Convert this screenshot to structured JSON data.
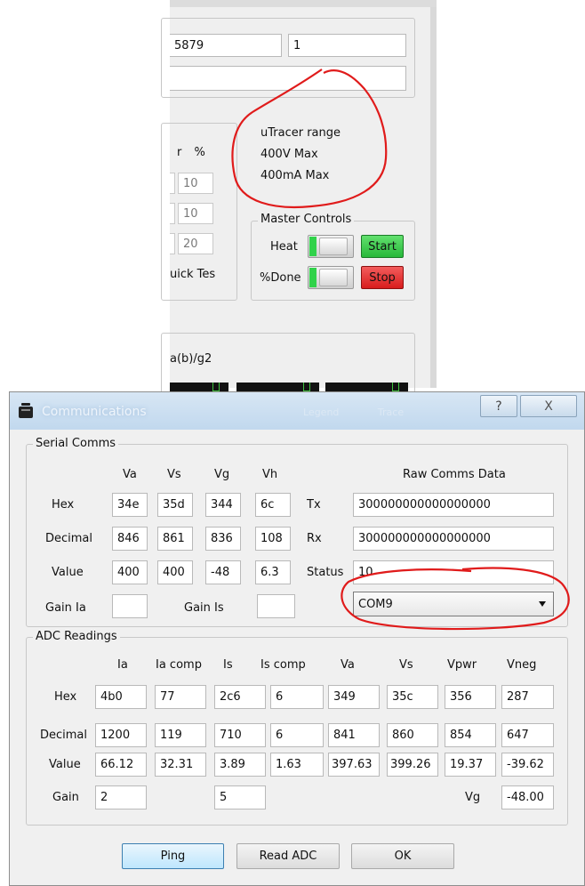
{
  "bg_window": {
    "row1": {
      "field_a": "5879",
      "field_b": "1"
    },
    "note": {
      "line1": "uTracer range",
      "line2": "400V Max",
      "line3": "400mA Max"
    },
    "percent_header": "r   %",
    "percent_fields": [
      "10",
      "10",
      "20"
    ],
    "quick_test_label": "uick Tes",
    "master_controls": {
      "title": "Master Controls",
      "heat_label": "Heat",
      "start_label": "Start",
      "done_label": "%Done",
      "stop_label": "Stop"
    },
    "graph_label": "a(b)/g2"
  },
  "dialog": {
    "title": "Communications",
    "behind_title_text": "Legend   Trace",
    "help_glyph": "?",
    "close_glyph": "X",
    "serial": {
      "title": "Serial Comms",
      "headers": [
        "Va",
        "Vs",
        "Vg",
        "Vh"
      ],
      "raw_header": "Raw Comms Data",
      "rows": [
        {
          "label": "Hex",
          "values": [
            "34e",
            "35d",
            "344",
            "6c"
          ],
          "side_label": "Tx",
          "side_value": "300000000000000000"
        },
        {
          "label": "Decimal",
          "values": [
            "846",
            "861",
            "836",
            "108"
          ],
          "side_label": "Rx",
          "side_value": "300000000000000000"
        },
        {
          "label": "Value",
          "values": [
            "400",
            "400",
            "-48",
            "6.3"
          ],
          "side_label": "Status",
          "side_value": "10"
        }
      ],
      "gain_ia_label": "Gain Ia",
      "gain_ia_value": "",
      "gain_is_label": "Gain Is",
      "gain_is_value": "",
      "port_selected": "COM9"
    },
    "adc": {
      "title": "ADC Readings",
      "headers": [
        "Ia",
        "Ia comp",
        "Is",
        "Is comp",
        "Va",
        "Vs",
        "Vpwr",
        "Vneg"
      ],
      "rows": [
        {
          "label": "Hex",
          "values": [
            "4b0",
            "77",
            "2c6",
            "6",
            "349",
            "35c",
            "356",
            "287"
          ]
        },
        {
          "label": "Decimal",
          "values": [
            "1200",
            "119",
            "710",
            "6",
            "841",
            "860",
            "854",
            "647"
          ]
        },
        {
          "label": "Value",
          "values": [
            "66.12",
            "32.31",
            "3.89",
            "1.63",
            "397.63",
            "399.26",
            "19.37",
            "-39.62"
          ]
        }
      ],
      "gain_label": "Gain",
      "gain_ia": "2",
      "gain_is": "5",
      "vg_label": "Vg",
      "vg_value": "-48.00"
    },
    "buttons": {
      "ping": "Ping",
      "read_adc": "Read ADC",
      "ok": "OK"
    }
  },
  "colors": {
    "annotation": "#e01b1b",
    "start_green": "#2ecc40",
    "stop_red": "#e82222",
    "dialog_bg": "#f0f0f0"
  }
}
